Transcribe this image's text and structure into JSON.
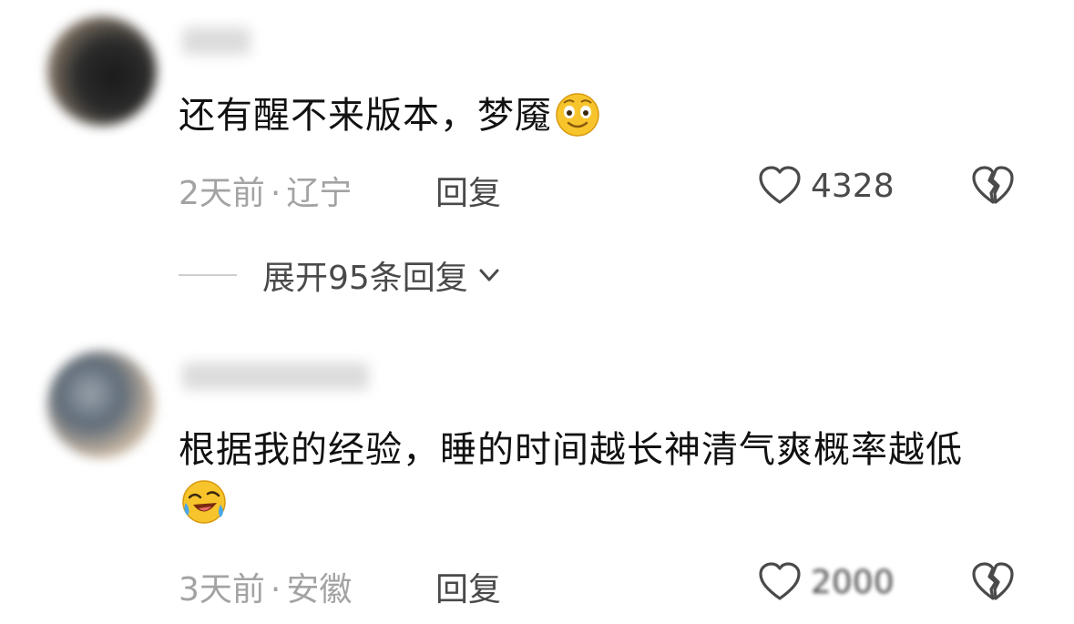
{
  "comments": [
    {
      "username": "",
      "text": "还有醒不来版本，梦魇",
      "emoji": "smiling-face-emoji",
      "time": "2天前",
      "separator": "·",
      "location": "辽宁",
      "reply_label": "回复",
      "like_count": "4328",
      "expand_label": "展开95条回复"
    },
    {
      "username": "",
      "text": "根据我的经验，睡的时间越长神清气爽概率越低",
      "emoji": "rolling-laughing-emoji",
      "time": "3天前",
      "separator": "·",
      "location": "安徽",
      "reply_label": "回复",
      "like_count": "2000"
    }
  ],
  "colors": {
    "text": "#111111",
    "meta": "#a3a3a3",
    "action": "#4a4a4a",
    "emoji_yellow": "#f7c52b"
  }
}
